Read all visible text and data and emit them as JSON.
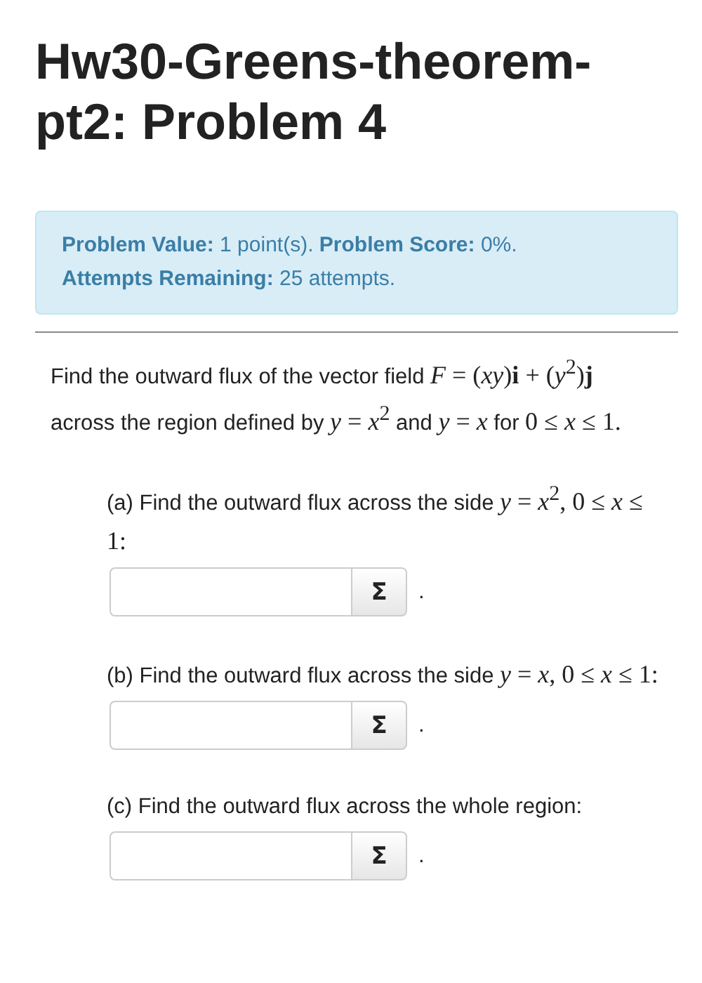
{
  "title": "Hw30-Greens-theorem-pt2: Problem 4",
  "info": [
    "**Problem Value:** 1 point(s). **Problem Score:** 0%.",
    "**Attempts Remaining:** 25 attempts."
  ],
  "problem": [
    {
      "kind": "text",
      "text": "Find the outward flux of the vector field "
    },
    {
      "kind": "math",
      "text": "*F* = (*xy*)**i** + (*y*$^{2}$)**j**"
    },
    {
      "kind": "text",
      "text": " across the region defined by "
    },
    {
      "kind": "math",
      "text": "*y* = *x*$^{2}$"
    },
    {
      "kind": "text",
      "text": " and "
    },
    {
      "kind": "math",
      "text": "*y* = *x*"
    },
    {
      "kind": "text",
      "text": " for "
    },
    {
      "kind": "math",
      "text": "0 ≤ *x* ≤ 1."
    }
  ],
  "parts": [
    {
      "kind": "field_below",
      "prompt": [
        {
          "kind": "text",
          "text": "(a) Find the outward flux across the side "
        },
        {
          "kind": "math",
          "text": "*y* = *x*$^{2}$, 0 ≤ *x* ≤ 1:"
        }
      ],
      "button": "Σ",
      "after": "."
    },
    {
      "kind": "field_inline",
      "prompt": [
        {
          "kind": "text",
          "text": "(b) Find the outward flux across the side "
        },
        {
          "kind": "math",
          "text": "*y* = *x*, 0 ≤ *x* ≤ 1:"
        }
      ],
      "button": "Σ",
      "after": "."
    },
    {
      "kind": "field_inline",
      "prompt": [
        {
          "kind": "text",
          "text": "(c) Find the outward flux across the whole region:"
        }
      ],
      "button": "Σ",
      "after": "."
    }
  ]
}
